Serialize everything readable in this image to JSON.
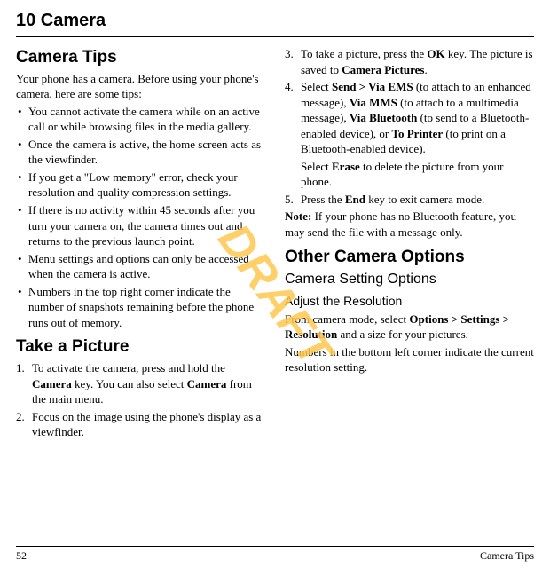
{
  "chapter": "10   Camera",
  "watermark": "DRAFT",
  "footer": {
    "page": "52",
    "section": "Camera Tips"
  },
  "left": {
    "s1": {
      "title": "Camera Tips",
      "intro": "Your phone has a camera. Before using your phone's camera, here are some tips:",
      "b1": "You cannot activate the camera while on an active call or while browsing files in the media gallery.",
      "b2": "Once the camera is active, the home screen acts as the viewfinder.",
      "b3": "If you get a \"Low memory\" error, check your resolution and quality compression settings.",
      "b4": "If there is no activity within 45 seconds after you turn your camera on, the camera times out and returns to the previous launch point.",
      "b5": "Menu settings and options can only be accessed when the camera is active.",
      "b6": "Numbers in the top right corner indicate the number of snapshots remaining before the phone runs out of memory."
    },
    "s2": {
      "title": "Take a Picture",
      "n1": "1.",
      "step1a": "To activate the camera, press and hold the ",
      "step1b": "Camera",
      "step1c": " key. You can also select ",
      "step1d": "Camera",
      "step1e": " from the main menu.",
      "n2": "2.",
      "step2": "Focus on the image using the phone's display as a viewfinder."
    }
  },
  "right": {
    "s2c": {
      "n3": "3.",
      "s3a": "To take a picture, press the ",
      "s3b": "OK",
      "s3c": " key. The picture is saved to ",
      "s3d": "Camera Pictures",
      "s3e": ".",
      "n4": "4.",
      "s4a": "Select ",
      "s4b": "Send > Via EMS",
      "s4c": " (to attach to an enhanced message), ",
      "s4d": "Via MMS",
      "s4e": " (to attach to a multimedia message), ",
      "s4f": "Via Bluetooth",
      "s4g": " (to send to a Bluetooth-enabled device), or ",
      "s4h": "To Printer",
      "s4i": " (to print on a Bluetooth-enabled device).",
      "sub_a": "Select ",
      "sub_b": "Erase",
      "sub_c": " to delete the picture from your phone.",
      "n5": "5.",
      "s5a": "Press the ",
      "s5b": "End",
      "s5c": " key to exit camera mode.",
      "note_a": "Note:",
      "note_b": " If your phone has no Bluetooth feature, you may send the file with a message only."
    },
    "s3": {
      "title": "Other Camera Options",
      "sub1": "Camera Setting Options",
      "sub2": "Adjust the Resolution",
      "p1a": "From camera mode, select ",
      "p1b": "Options > Settings > Resolution",
      "p1c": " and a size for your pictures.",
      "p2": "Numbers in the bottom left corner indicate the current resolution setting."
    }
  }
}
